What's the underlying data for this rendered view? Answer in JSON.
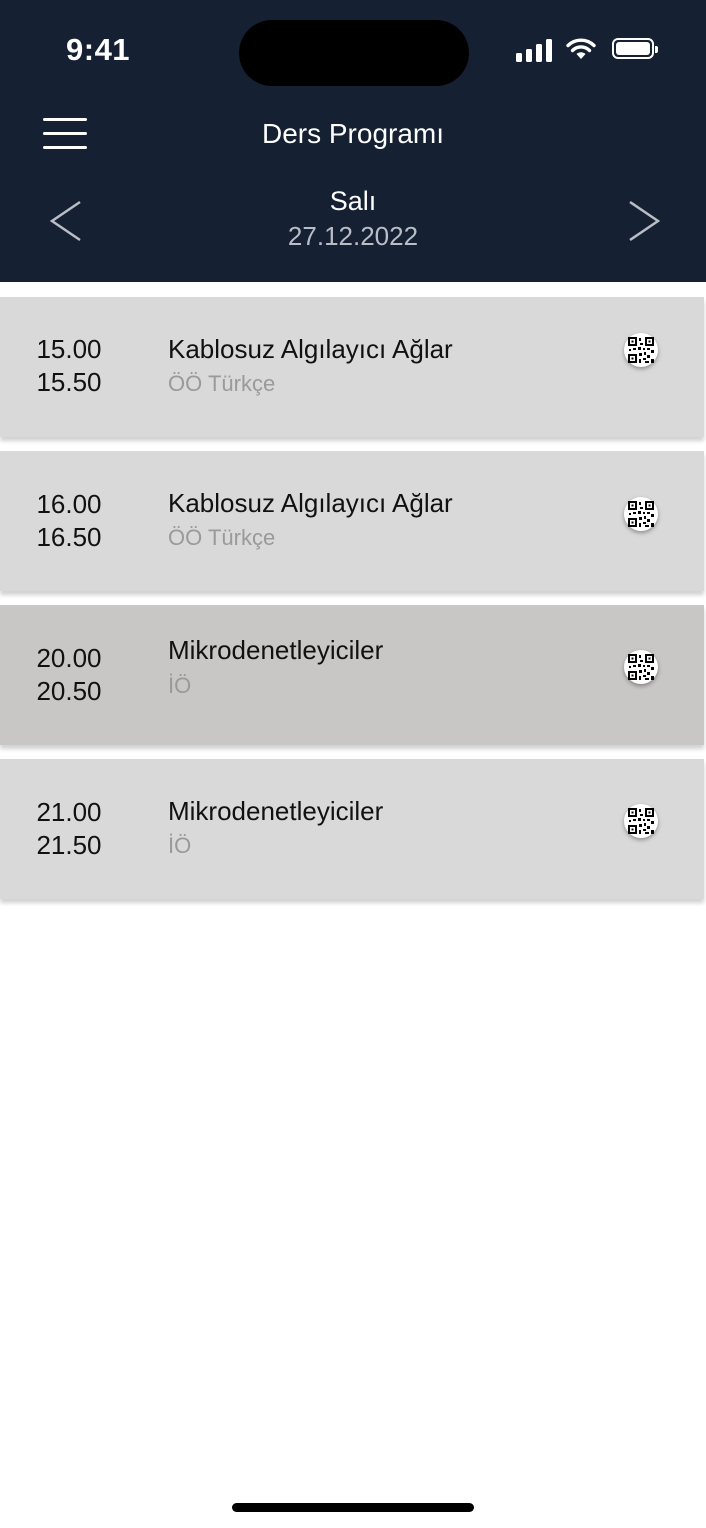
{
  "status_bar": {
    "time": "9:41"
  },
  "header": {
    "title": "Ders Programı",
    "day_name": "Salı",
    "date": "27.12.2022",
    "prev_label": "<",
    "next_label": ">"
  },
  "lessons": [
    {
      "start": "15.00",
      "end": "15.50",
      "name": "Kablosuz Algılayıcı Ağlar",
      "detail": "ÖÖ Türkçe",
      "selected": false
    },
    {
      "start": "16.00",
      "end": "16.50",
      "name": "Kablosuz Algılayıcı Ağlar",
      "detail": "ÖÖ Türkçe",
      "selected": false
    },
    {
      "start": "20.00",
      "end": "20.50",
      "name": "Mikrodenetleyiciler",
      "detail": "İÖ",
      "selected": true
    },
    {
      "start": "21.00",
      "end": "21.50",
      "name": "Mikrodenetleyiciler",
      "detail": "İÖ",
      "selected": false
    }
  ],
  "colors": {
    "header_bg": "#152033",
    "card_bg": "#d9d9d9",
    "card_selected_bg": "#c9c6c6"
  },
  "icons": {
    "menu": "hamburger-icon",
    "prev": "chevron-left-icon",
    "next": "chevron-right-icon",
    "qr": "qr-code-icon"
  }
}
